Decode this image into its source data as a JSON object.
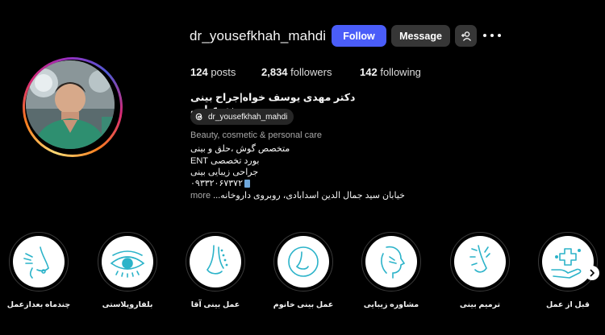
{
  "profile": {
    "username": "dr_yousefkhah_mahdi",
    "follow_label": "Follow",
    "message_label": "Message",
    "stats": {
      "posts_count": "124",
      "posts_label": "posts",
      "followers_count": "2,834",
      "followers_label": "followers",
      "following_count": "142",
      "following_label": "following"
    },
    "full_name": "دکتر مهدی یوسف خواه|جراح بینی ،بندرعباس",
    "threads_handle": "dr_yousefkhah_mahdi",
    "category": "Beauty, cosmetic & personal care",
    "bio_lines": [
      "متخصص گوش ،حلق و بینی",
      "بورد تخصصی ENT",
      "جراحی زیبایی بینی",
      "۰۹۳۳۲۰۶۷۳۷۲"
    ],
    "bio_address": "خیابان سید جمال الدین اسدابادی، روبروی داروخانه...",
    "more_label": "more"
  },
  "highlights": [
    {
      "label": "چندماه بعدازعمل",
      "icon": "nose-profile-icon"
    },
    {
      "label": "بلفاروپلاستی",
      "icon": "eye-icon"
    },
    {
      "label": "عمل بینی آقا",
      "icon": "nose-dots-icon"
    },
    {
      "label": "عمل بینی خانوم",
      "icon": "nose-circle-icon"
    },
    {
      "label": "مشاوره زیبایی",
      "icon": "face-profile-icon"
    },
    {
      "label": "ترمیم بینی",
      "icon": "nose-repair-icon"
    },
    {
      "label": "قبل از عمل",
      "icon": "hand-cross-icon"
    }
  ],
  "colors": {
    "follow_button": "#4a5df9",
    "secondary_button": "#363636",
    "highlight_icon": "#2bb3c9",
    "background": "#000000"
  }
}
